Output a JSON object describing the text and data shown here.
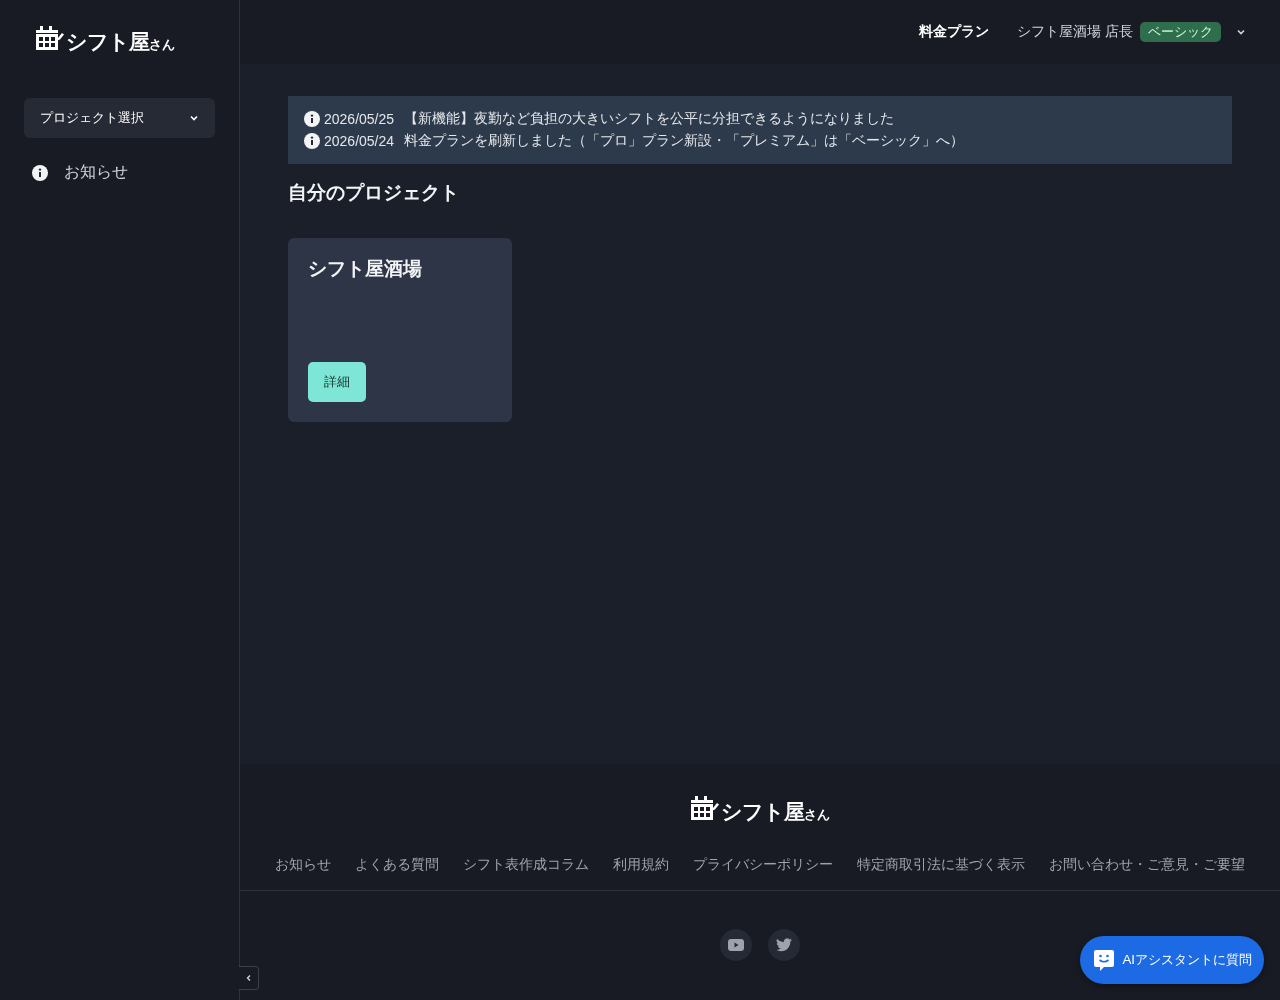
{
  "sidebar": {
    "logo": {
      "name": "シフト屋",
      "suffix": "さん"
    },
    "project_select": {
      "label": "プロジェクト選択"
    },
    "items": [
      {
        "label": "お知らせ"
      }
    ]
  },
  "header": {
    "plan_link": "料金プラン",
    "user": "シフト屋酒場 店長",
    "plan_badge": "ベーシック"
  },
  "notices": [
    {
      "date": "2026/05/25",
      "text": "【新機能】夜勤など負担の大きいシフトを公平に分担できるようになりました"
    },
    {
      "date": "2026/05/24",
      "text": "料金プランを刷新しました（「プロ」プラン新設・「プレミアム」は「ベーシック」へ）"
    }
  ],
  "section_title": "自分のプロジェクト",
  "projects": [
    {
      "name": "シフト屋酒場",
      "button": "詳細"
    }
  ],
  "footer": {
    "logo": {
      "name": "シフト屋",
      "suffix": "さん"
    },
    "links": [
      "お知らせ",
      "よくある質問",
      "シフト表作成コラム",
      "利用規約",
      "プライバシーポリシー",
      "特定商取引法に基づく表示",
      "お問い合わせ・ご意見・ご要望"
    ]
  },
  "assistant_button": "AIアシスタントに質問"
}
